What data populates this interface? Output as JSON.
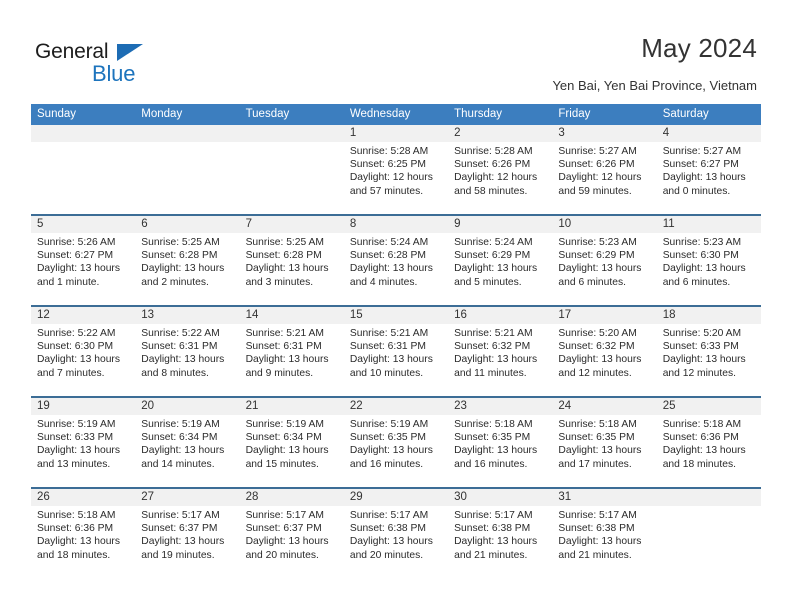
{
  "brand": {
    "name_top": "General",
    "name_bottom": "Blue",
    "triangle_icon": "triangle-icon",
    "accent_color": "#1d74bd"
  },
  "header": {
    "title": "May 2024",
    "subtitle": "Yen Bai, Yen Bai Province, Vietnam"
  },
  "calendar": {
    "header_bg": "#3c7ebf",
    "row_divider": "#3c6d96",
    "day_band_bg": "#f1f1f1",
    "weekdays": [
      "Sunday",
      "Monday",
      "Tuesday",
      "Wednesday",
      "Thursday",
      "Friday",
      "Saturday"
    ],
    "weeks": [
      [
        {
          "date": "",
          "empty": true,
          "sunrise": "",
          "sunset": "",
          "daylight_1": "",
          "daylight_2": ""
        },
        {
          "date": "",
          "empty": true,
          "sunrise": "",
          "sunset": "",
          "daylight_1": "",
          "daylight_2": ""
        },
        {
          "date": "",
          "empty": true,
          "sunrise": "",
          "sunset": "",
          "daylight_1": "",
          "daylight_2": ""
        },
        {
          "date": "1",
          "sunrise": "Sunrise: 5:28 AM",
          "sunset": "Sunset: 6:25 PM",
          "daylight_1": "Daylight: 12 hours",
          "daylight_2": "and 57 minutes."
        },
        {
          "date": "2",
          "sunrise": "Sunrise: 5:28 AM",
          "sunset": "Sunset: 6:26 PM",
          "daylight_1": "Daylight: 12 hours",
          "daylight_2": "and 58 minutes."
        },
        {
          "date": "3",
          "sunrise": "Sunrise: 5:27 AM",
          "sunset": "Sunset: 6:26 PM",
          "daylight_1": "Daylight: 12 hours",
          "daylight_2": "and 59 minutes."
        },
        {
          "date": "4",
          "sunrise": "Sunrise: 5:27 AM",
          "sunset": "Sunset: 6:27 PM",
          "daylight_1": "Daylight: 13 hours",
          "daylight_2": "and 0 minutes."
        }
      ],
      [
        {
          "date": "5",
          "sunrise": "Sunrise: 5:26 AM",
          "sunset": "Sunset: 6:27 PM",
          "daylight_1": "Daylight: 13 hours",
          "daylight_2": "and 1 minute."
        },
        {
          "date": "6",
          "sunrise": "Sunrise: 5:25 AM",
          "sunset": "Sunset: 6:28 PM",
          "daylight_1": "Daylight: 13 hours",
          "daylight_2": "and 2 minutes."
        },
        {
          "date": "7",
          "sunrise": "Sunrise: 5:25 AM",
          "sunset": "Sunset: 6:28 PM",
          "daylight_1": "Daylight: 13 hours",
          "daylight_2": "and 3 minutes."
        },
        {
          "date": "8",
          "sunrise": "Sunrise: 5:24 AM",
          "sunset": "Sunset: 6:28 PM",
          "daylight_1": "Daylight: 13 hours",
          "daylight_2": "and 4 minutes."
        },
        {
          "date": "9",
          "sunrise": "Sunrise: 5:24 AM",
          "sunset": "Sunset: 6:29 PM",
          "daylight_1": "Daylight: 13 hours",
          "daylight_2": "and 5 minutes."
        },
        {
          "date": "10",
          "sunrise": "Sunrise: 5:23 AM",
          "sunset": "Sunset: 6:29 PM",
          "daylight_1": "Daylight: 13 hours",
          "daylight_2": "and 6 minutes."
        },
        {
          "date": "11",
          "sunrise": "Sunrise: 5:23 AM",
          "sunset": "Sunset: 6:30 PM",
          "daylight_1": "Daylight: 13 hours",
          "daylight_2": "and 6 minutes."
        }
      ],
      [
        {
          "date": "12",
          "sunrise": "Sunrise: 5:22 AM",
          "sunset": "Sunset: 6:30 PM",
          "daylight_1": "Daylight: 13 hours",
          "daylight_2": "and 7 minutes."
        },
        {
          "date": "13",
          "sunrise": "Sunrise: 5:22 AM",
          "sunset": "Sunset: 6:31 PM",
          "daylight_1": "Daylight: 13 hours",
          "daylight_2": "and 8 minutes."
        },
        {
          "date": "14",
          "sunrise": "Sunrise: 5:21 AM",
          "sunset": "Sunset: 6:31 PM",
          "daylight_1": "Daylight: 13 hours",
          "daylight_2": "and 9 minutes."
        },
        {
          "date": "15",
          "sunrise": "Sunrise: 5:21 AM",
          "sunset": "Sunset: 6:31 PM",
          "daylight_1": "Daylight: 13 hours",
          "daylight_2": "and 10 minutes."
        },
        {
          "date": "16",
          "sunrise": "Sunrise: 5:21 AM",
          "sunset": "Sunset: 6:32 PM",
          "daylight_1": "Daylight: 13 hours",
          "daylight_2": "and 11 minutes."
        },
        {
          "date": "17",
          "sunrise": "Sunrise: 5:20 AM",
          "sunset": "Sunset: 6:32 PM",
          "daylight_1": "Daylight: 13 hours",
          "daylight_2": "and 12 minutes."
        },
        {
          "date": "18",
          "sunrise": "Sunrise: 5:20 AM",
          "sunset": "Sunset: 6:33 PM",
          "daylight_1": "Daylight: 13 hours",
          "daylight_2": "and 12 minutes."
        }
      ],
      [
        {
          "date": "19",
          "sunrise": "Sunrise: 5:19 AM",
          "sunset": "Sunset: 6:33 PM",
          "daylight_1": "Daylight: 13 hours",
          "daylight_2": "and 13 minutes."
        },
        {
          "date": "20",
          "sunrise": "Sunrise: 5:19 AM",
          "sunset": "Sunset: 6:34 PM",
          "daylight_1": "Daylight: 13 hours",
          "daylight_2": "and 14 minutes."
        },
        {
          "date": "21",
          "sunrise": "Sunrise: 5:19 AM",
          "sunset": "Sunset: 6:34 PM",
          "daylight_1": "Daylight: 13 hours",
          "daylight_2": "and 15 minutes."
        },
        {
          "date": "22",
          "sunrise": "Sunrise: 5:19 AM",
          "sunset": "Sunset: 6:35 PM",
          "daylight_1": "Daylight: 13 hours",
          "daylight_2": "and 16 minutes."
        },
        {
          "date": "23",
          "sunrise": "Sunrise: 5:18 AM",
          "sunset": "Sunset: 6:35 PM",
          "daylight_1": "Daylight: 13 hours",
          "daylight_2": "and 16 minutes."
        },
        {
          "date": "24",
          "sunrise": "Sunrise: 5:18 AM",
          "sunset": "Sunset: 6:35 PM",
          "daylight_1": "Daylight: 13 hours",
          "daylight_2": "and 17 minutes."
        },
        {
          "date": "25",
          "sunrise": "Sunrise: 5:18 AM",
          "sunset": "Sunset: 6:36 PM",
          "daylight_1": "Daylight: 13 hours",
          "daylight_2": "and 18 minutes."
        }
      ],
      [
        {
          "date": "26",
          "sunrise": "Sunrise: 5:18 AM",
          "sunset": "Sunset: 6:36 PM",
          "daylight_1": "Daylight: 13 hours",
          "daylight_2": "and 18 minutes."
        },
        {
          "date": "27",
          "sunrise": "Sunrise: 5:17 AM",
          "sunset": "Sunset: 6:37 PM",
          "daylight_1": "Daylight: 13 hours",
          "daylight_2": "and 19 minutes."
        },
        {
          "date": "28",
          "sunrise": "Sunrise: 5:17 AM",
          "sunset": "Sunset: 6:37 PM",
          "daylight_1": "Daylight: 13 hours",
          "daylight_2": "and 20 minutes."
        },
        {
          "date": "29",
          "sunrise": "Sunrise: 5:17 AM",
          "sunset": "Sunset: 6:38 PM",
          "daylight_1": "Daylight: 13 hours",
          "daylight_2": "and 20 minutes."
        },
        {
          "date": "30",
          "sunrise": "Sunrise: 5:17 AM",
          "sunset": "Sunset: 6:38 PM",
          "daylight_1": "Daylight: 13 hours",
          "daylight_2": "and 21 minutes."
        },
        {
          "date": "31",
          "sunrise": "Sunrise: 5:17 AM",
          "sunset": "Sunset: 6:38 PM",
          "daylight_1": "Daylight: 13 hours",
          "daylight_2": "and 21 minutes."
        },
        {
          "date": "",
          "empty": true,
          "sunrise": "",
          "sunset": "",
          "daylight_1": "",
          "daylight_2": ""
        }
      ]
    ]
  }
}
